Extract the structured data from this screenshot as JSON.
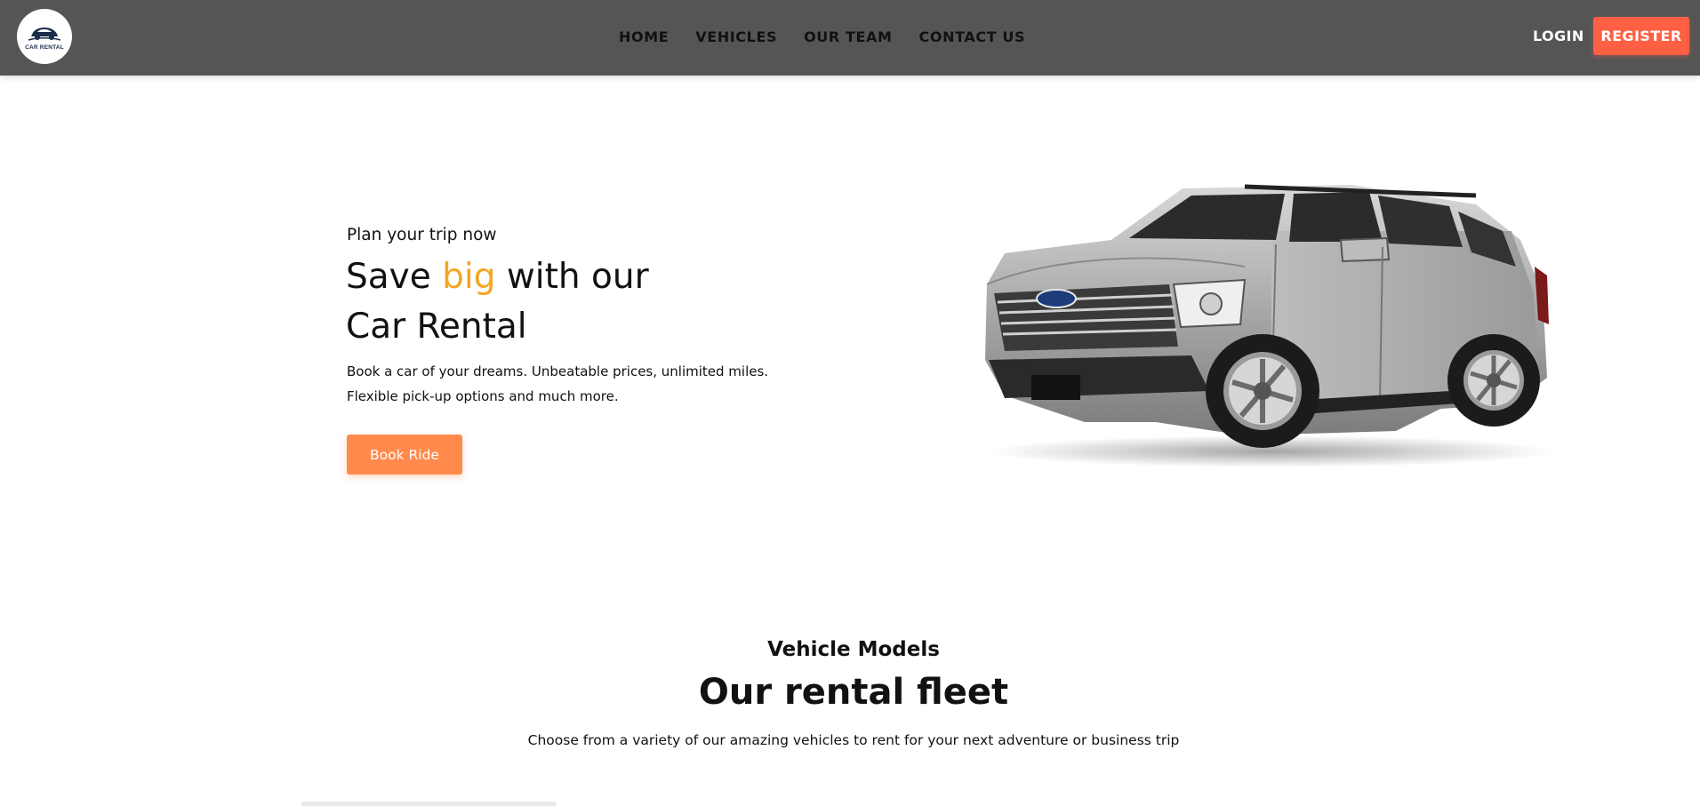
{
  "brand": {
    "logo_text": "CAR RENTAL",
    "icon": "car-logo-icon",
    "colors": {
      "navbar": "#555555",
      "logo_accent": "#1c2c4c"
    }
  },
  "nav": {
    "links": [
      {
        "label": "HOME"
      },
      {
        "label": "VEHICLES"
      },
      {
        "label": "OUR TEAM"
      },
      {
        "label": "CONTACT US"
      }
    ],
    "login_label": "LOGIN",
    "register_label": "REGISTER",
    "colors": {
      "register_bg": "#ff5f43"
    }
  },
  "hero": {
    "subtitle": "Plan your trip now",
    "title_part1": "Save ",
    "title_accent": "big",
    "title_part2": " with our",
    "title_line2": "Car Rental",
    "description_line1": "Book a car of your dreams. Unbeatable prices, unlimited miles.",
    "description_line2": "Flexible pick-up options and much more.",
    "cta_label": "Book Ride",
    "image": "silver-suv-image",
    "colors": {
      "accent": "#f5a623",
      "cta_bg": "#ff8a4c"
    }
  },
  "fleet": {
    "subtitle": "Vehicle Models",
    "title": "Our rental fleet",
    "description": "Choose from a variety of our amazing vehicles to rent for your next adventure or business trip"
  }
}
